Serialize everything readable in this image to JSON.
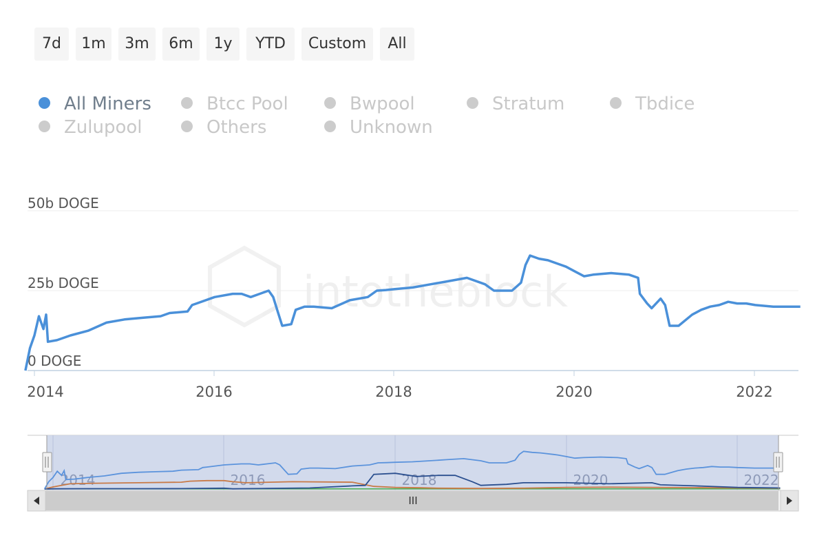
{
  "range_selector": {
    "buttons": [
      {
        "label": "7d"
      },
      {
        "label": "1m"
      },
      {
        "label": "3m"
      },
      {
        "label": "6m"
      },
      {
        "label": "1y"
      },
      {
        "label": "YTD"
      },
      {
        "label": "Custom"
      },
      {
        "label": "All"
      }
    ]
  },
  "legend": {
    "items": [
      {
        "label": "All Miners",
        "active": true,
        "color": "#4a90d9"
      },
      {
        "label": "Btcc Pool",
        "active": false,
        "color": "#cccccc"
      },
      {
        "label": "Bwpool",
        "active": false,
        "color": "#cccccc"
      },
      {
        "label": "Stratum",
        "active": false,
        "color": "#cccccc"
      },
      {
        "label": "Tbdice",
        "active": false,
        "color": "#cccccc"
      },
      {
        "label": "Zulupool",
        "active": false,
        "color": "#cccccc"
      },
      {
        "label": "Others",
        "active": false,
        "color": "#cccccc"
      },
      {
        "label": "Unknown",
        "active": false,
        "color": "#cccccc"
      }
    ]
  },
  "watermark": "intotheblock",
  "navigator": {
    "x_ticks": [
      "2014",
      "2016",
      "2018",
      "2020",
      "2022"
    ],
    "scroll_grip": "III",
    "colors": {
      "all_miners": "#5b93dc",
      "dark": "#2b4f8f",
      "orange": "#c87a46",
      "green": "#4caf50"
    },
    "orange_series": [
      [
        2013.9,
        0
      ],
      [
        2014.0,
        2
      ],
      [
        2014.2,
        5
      ],
      [
        2014.5,
        5.5
      ],
      [
        2015.0,
        6
      ],
      [
        2015.5,
        6.5
      ],
      [
        2015.6,
        7.5
      ],
      [
        2015.8,
        8
      ],
      [
        2016.0,
        8
      ],
      [
        2016.1,
        7
      ],
      [
        2016.25,
        6
      ],
      [
        2016.8,
        7
      ],
      [
        2017.5,
        6.5
      ],
      [
        2017.75,
        2.5
      ],
      [
        2018.0,
        1.5
      ],
      [
        2018.3,
        1.2
      ],
      [
        2018.5,
        0.8
      ],
      [
        2019.0,
        0.5
      ],
      [
        2019.5,
        0.8
      ],
      [
        2020.0,
        1.5
      ],
      [
        2020.5,
        1.8
      ],
      [
        2021.0,
        1.5
      ],
      [
        2021.5,
        1.3
      ],
      [
        2022.0,
        1.0
      ],
      [
        2022.5,
        0.8
      ]
    ],
    "dark_series": [
      [
        2013.9,
        0
      ],
      [
        2014.0,
        0.2
      ],
      [
        2014.5,
        0.3
      ],
      [
        2015.0,
        0.3
      ],
      [
        2015.5,
        0.4
      ],
      [
        2016.0,
        0.8
      ],
      [
        2016.1,
        0.2
      ],
      [
        2016.5,
        0.5
      ],
      [
        2017.0,
        1.0
      ],
      [
        2017.5,
        3
      ],
      [
        2017.65,
        3.5
      ],
      [
        2017.75,
        14
      ],
      [
        2018.0,
        15
      ],
      [
        2018.25,
        12
      ],
      [
        2018.5,
        13
      ],
      [
        2018.7,
        13
      ],
      [
        2018.9,
        7
      ],
      [
        2019.0,
        3.5
      ],
      [
        2019.3,
        4.5
      ],
      [
        2019.5,
        6
      ],
      [
        2020.0,
        6
      ],
      [
        2020.5,
        5
      ],
      [
        2021.0,
        6
      ],
      [
        2021.1,
        4
      ],
      [
        2021.5,
        3
      ],
      [
        2022.0,
        1.5
      ],
      [
        2022.5,
        1.0
      ]
    ],
    "green_series": [
      [
        2013.9,
        0.1
      ],
      [
        2022.5,
        0.1
      ]
    ]
  },
  "chart_data": {
    "type": "line",
    "title": "",
    "xlabel": "",
    "ylabel": "",
    "y_ticks": [
      "0 DOGE",
      "25b DOGE",
      "50b DOGE"
    ],
    "x_ticks": [
      "2014",
      "2016",
      "2018",
      "2020",
      "2022"
    ],
    "xlim": [
      2013.9,
      2022.5
    ],
    "ylim": [
      0,
      50
    ],
    "unit": "b DOGE",
    "legend_position": "top",
    "grid": true,
    "series": [
      {
        "name": "All Miners",
        "color": "#4a90d9",
        "points": [
          [
            2013.9,
            0
          ],
          [
            2013.95,
            7
          ],
          [
            2014.0,
            11
          ],
          [
            2014.05,
            17
          ],
          [
            2014.1,
            13
          ],
          [
            2014.13,
            17.5
          ],
          [
            2014.15,
            9
          ],
          [
            2014.25,
            9.5
          ],
          [
            2014.4,
            11
          ],
          [
            2014.6,
            12.5
          ],
          [
            2014.8,
            15
          ],
          [
            2015.0,
            16
          ],
          [
            2015.2,
            16.5
          ],
          [
            2015.4,
            17
          ],
          [
            2015.5,
            18
          ],
          [
            2015.7,
            18.5
          ],
          [
            2015.75,
            20.5
          ],
          [
            2015.8,
            21
          ],
          [
            2016.0,
            23
          ],
          [
            2016.2,
            24
          ],
          [
            2016.3,
            24
          ],
          [
            2016.4,
            23
          ],
          [
            2016.5,
            24
          ],
          [
            2016.6,
            25
          ],
          [
            2016.65,
            23
          ],
          [
            2016.7,
            18.5
          ],
          [
            2016.75,
            14
          ],
          [
            2016.85,
            14.5
          ],
          [
            2016.9,
            19
          ],
          [
            2017.0,
            20
          ],
          [
            2017.1,
            20
          ],
          [
            2017.3,
            19.5
          ],
          [
            2017.5,
            22
          ],
          [
            2017.7,
            23
          ],
          [
            2017.8,
            25
          ],
          [
            2017.9,
            25.2
          ],
          [
            2018.0,
            25.5
          ],
          [
            2018.2,
            26
          ],
          [
            2018.4,
            27
          ],
          [
            2018.6,
            28
          ],
          [
            2018.8,
            29
          ],
          [
            2019.0,
            27
          ],
          [
            2019.1,
            25
          ],
          [
            2019.3,
            25
          ],
          [
            2019.4,
            27.5
          ],
          [
            2019.45,
            33
          ],
          [
            2019.5,
            36
          ],
          [
            2019.6,
            35
          ],
          [
            2019.7,
            34.5
          ],
          [
            2019.85,
            33
          ],
          [
            2019.9,
            32.5
          ],
          [
            2020.0,
            31
          ],
          [
            2020.1,
            29.5
          ],
          [
            2020.2,
            30
          ],
          [
            2020.4,
            30.5
          ],
          [
            2020.6,
            30
          ],
          [
            2020.7,
            29
          ],
          [
            2020.72,
            24
          ],
          [
            2020.8,
            21
          ],
          [
            2020.85,
            19.5
          ],
          [
            2020.9,
            21
          ],
          [
            2020.95,
            22.5
          ],
          [
            2021.0,
            20.5
          ],
          [
            2021.05,
            14
          ],
          [
            2021.15,
            14
          ],
          [
            2021.3,
            17.5
          ],
          [
            2021.4,
            19
          ],
          [
            2021.5,
            20
          ],
          [
            2021.6,
            20.5
          ],
          [
            2021.7,
            21.5
          ],
          [
            2021.8,
            21
          ],
          [
            2021.9,
            21
          ],
          [
            2022.0,
            20.5
          ],
          [
            2022.2,
            20
          ],
          [
            2022.3,
            20
          ],
          [
            2022.4,
            20
          ],
          [
            2022.5,
            20
          ]
        ]
      }
    ]
  }
}
